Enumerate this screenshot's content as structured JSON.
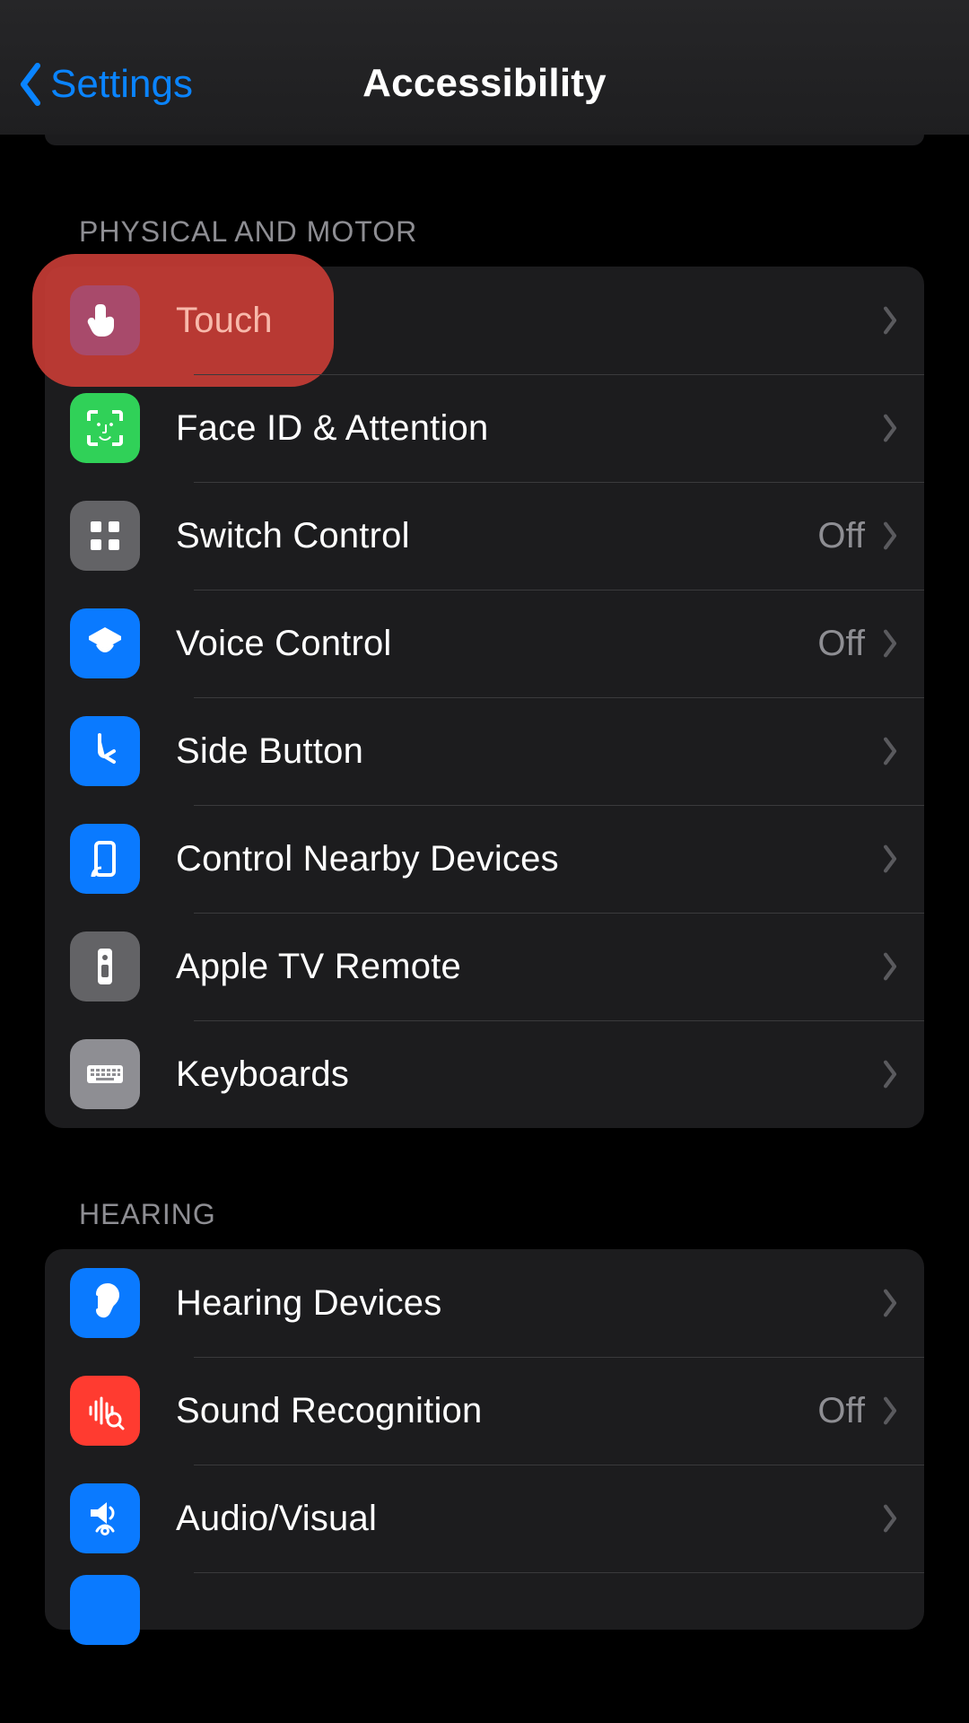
{
  "nav": {
    "back": "Settings",
    "title": "Accessibility"
  },
  "sections": [
    {
      "header": "PHYSICAL AND MOTOR",
      "items": [
        {
          "icon": "touch",
          "label": "Touch",
          "value": "",
          "hl": true,
          "bg": "bg-blue"
        },
        {
          "icon": "faceid",
          "label": "Face ID & Attention",
          "value": "",
          "bg": "bg-green"
        },
        {
          "icon": "switch",
          "label": "Switch Control",
          "value": "Off",
          "bg": "bg-gray"
        },
        {
          "icon": "voice",
          "label": "Voice Control",
          "value": "Off",
          "bg": "bg-blue"
        },
        {
          "icon": "sidebtn",
          "label": "Side Button",
          "value": "",
          "bg": "bg-blue"
        },
        {
          "icon": "nearby",
          "label": "Control Nearby Devices",
          "value": "",
          "bg": "bg-blue"
        },
        {
          "icon": "tvremote",
          "label": "Apple TV Remote",
          "value": "",
          "bg": "bg-gray"
        },
        {
          "icon": "keyboard",
          "label": "Keyboards",
          "value": "",
          "bg": "bg-graylt"
        }
      ]
    },
    {
      "header": "HEARING",
      "items": [
        {
          "icon": "ear",
          "label": "Hearing Devices",
          "value": "",
          "bg": "bg-blue"
        },
        {
          "icon": "soundrec",
          "label": "Sound Recognition",
          "value": "Off",
          "bg": "bg-red"
        },
        {
          "icon": "audiovis",
          "label": "Audio/Visual",
          "value": "",
          "bg": "bg-blue"
        },
        {
          "icon": "peek",
          "label": "",
          "value": "",
          "bg": "bg-blue",
          "peek": true
        }
      ]
    }
  ]
}
